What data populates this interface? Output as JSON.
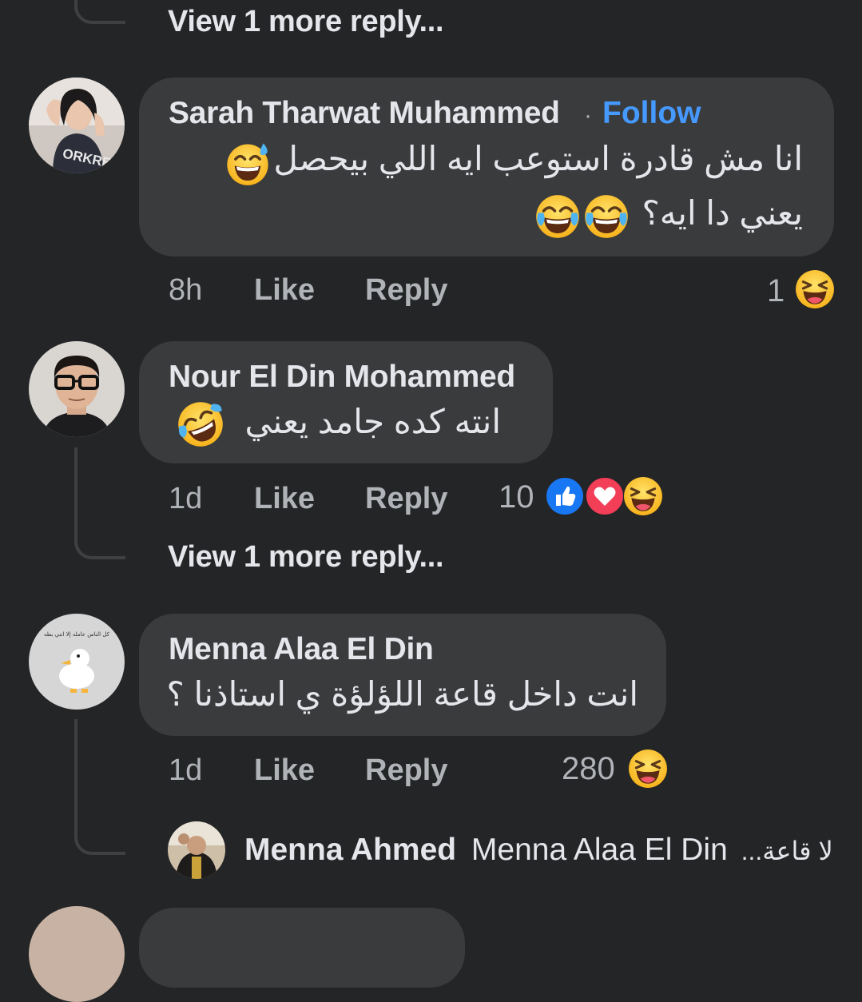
{
  "top": {
    "view_more": "View 1 more reply..."
  },
  "comments": [
    {
      "author": "Sarah Tharwat Muhammed",
      "separator": "·",
      "follow": "Follow",
      "line1": "انا مش قادرة استوعب ايه اللي بيحصل",
      "line2": "يعني دا ايه؟",
      "time": "8h",
      "like": "Like",
      "reply": "Reply",
      "reaction_count": "1"
    },
    {
      "author": "Nour El Din Mohammed",
      "line1": "انته كده جامد يعني",
      "time": "1d",
      "like": "Like",
      "reply": "Reply",
      "reaction_count": "10",
      "view_more": "View 1 more reply..."
    },
    {
      "author": "Menna Alaa El Din",
      "line1": "انت داخل قاعة اللؤلؤة ي استاذنا ؟",
      "time": "1d",
      "like": "Like",
      "reply": "Reply",
      "reaction_count": "280"
    }
  ],
  "reply_preview": {
    "author": "Menna Ahmed",
    "mention": "Menna Alaa El Din",
    "snippet": "لا قاعة..."
  },
  "avatar3_caption": "كل الناس عامله إلا انني بطه",
  "emojis": [
    "sweat-smile",
    "joy",
    "laughing",
    "like",
    "love"
  ],
  "colors": {
    "background": "#242526",
    "bubble": "#3a3b3c",
    "text": "#e4e6eb",
    "secondary_text": "#b0b3b8",
    "follow": "#4599ff",
    "like_reaction": "#1877f2",
    "love_reaction": "#f33e58",
    "emoji_yellow": "#fcc21b"
  }
}
